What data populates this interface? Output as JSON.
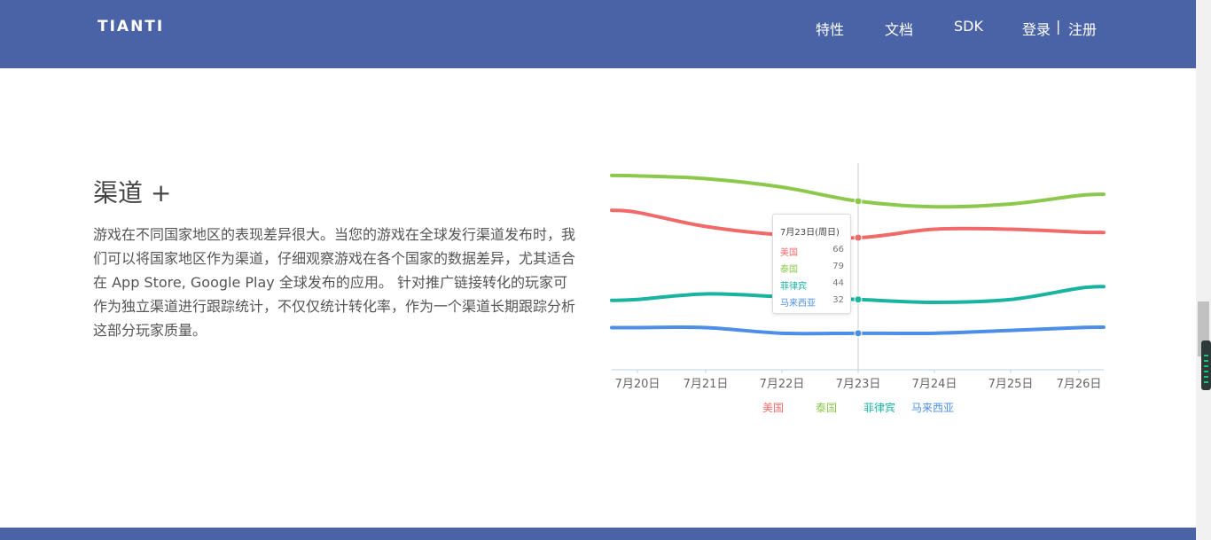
{
  "header": {
    "logo": "TIANTI",
    "nav": [
      {
        "label": "特性"
      },
      {
        "label": "文档"
      },
      {
        "label": "SDK"
      }
    ],
    "login": "登录",
    "divider": "|",
    "register": "注册"
  },
  "section": {
    "title": "渠道 +",
    "description": "游戏在不同国家地区的表现差异很大。当您的游戏在全球发行渠道发布时，我们可以将国家地区作为渠道，仔细观察游戏在各个国家的数据差异，尤其适合在 App Store, Google Play 全球发布的应用。 针对推广链接转化的玩家可作为独立渠道进行跟踪统计，不仅仅统计转化率，作为一个渠道长期跟踪分析这部分玩家质量。"
  },
  "chart_data": {
    "type": "line",
    "categories": [
      "7月20日",
      "7月21日",
      "7月22日",
      "7月23日",
      "7月24日",
      "7月25日",
      "7月26日"
    ],
    "grid": false,
    "legend_position": "bottom",
    "series": [
      {
        "name": "美国",
        "color": "#f06a6a",
        "values": [
          75,
          70,
          67,
          66,
          69,
          69,
          68
        ]
      },
      {
        "name": "泰国",
        "color": "#8cc84b",
        "values": [
          88,
          87,
          84,
          79,
          77,
          78,
          81
        ]
      },
      {
        "name": "菲律宾",
        "color": "#19b4a0",
        "values": [
          44,
          46,
          45,
          44,
          43,
          44,
          48
        ]
      },
      {
        "name": "马来西亚",
        "color": "#4d8fe6",
        "values": [
          34,
          34,
          32,
          32,
          32,
          33,
          34
        ]
      }
    ],
    "tooltip": {
      "title": "7月23日(周日)",
      "rows": [
        {
          "name": "美国",
          "value": "66",
          "color": "#f06a6a"
        },
        {
          "name": "泰国",
          "value": "79",
          "color": "#8cc84b"
        },
        {
          "name": "菲律宾",
          "value": "44",
          "color": "#19b4a0"
        },
        {
          "name": "马来西亚",
          "value": "32",
          "color": "#4d8fe6"
        }
      ]
    }
  }
}
